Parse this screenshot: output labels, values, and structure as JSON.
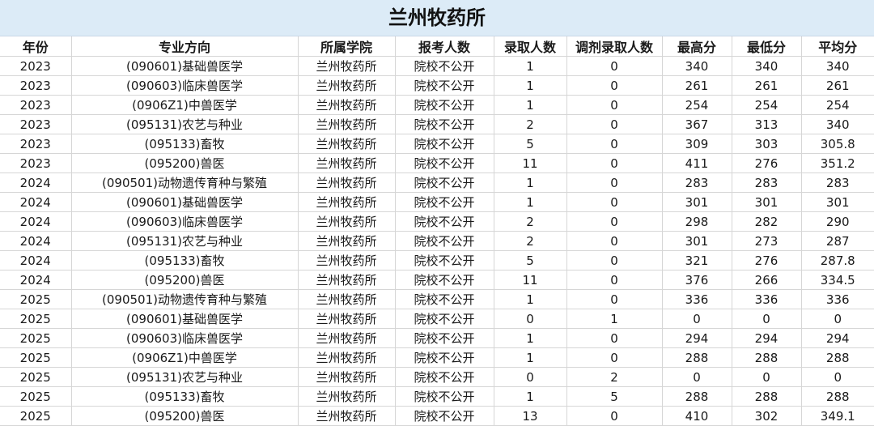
{
  "title": "兰州牧药所",
  "headers": [
    "年份",
    "专业方向",
    "所属学院",
    "报考人数",
    "录取人数",
    "调剂录取人数",
    "最高分",
    "最低分",
    "平均分"
  ],
  "rows": [
    [
      "2023",
      "(090601)基础兽医学",
      "兰州牧药所",
      "院校不公开",
      "1",
      "0",
      "340",
      "340",
      "340"
    ],
    [
      "2023",
      "(090603)临床兽医学",
      "兰州牧药所",
      "院校不公开",
      "1",
      "0",
      "261",
      "261",
      "261"
    ],
    [
      "2023",
      "(0906Z1)中兽医学",
      "兰州牧药所",
      "院校不公开",
      "1",
      "0",
      "254",
      "254",
      "254"
    ],
    [
      "2023",
      "(095131)农艺与种业",
      "兰州牧药所",
      "院校不公开",
      "2",
      "0",
      "367",
      "313",
      "340"
    ],
    [
      "2023",
      "(095133)畜牧",
      "兰州牧药所",
      "院校不公开",
      "5",
      "0",
      "309",
      "303",
      "305.8"
    ],
    [
      "2023",
      "(095200)兽医",
      "兰州牧药所",
      "院校不公开",
      "11",
      "0",
      "411",
      "276",
      "351.2"
    ],
    [
      "2024",
      "(090501)动物遗传育种与繁殖",
      "兰州牧药所",
      "院校不公开",
      "1",
      "0",
      "283",
      "283",
      "283"
    ],
    [
      "2024",
      "(090601)基础兽医学",
      "兰州牧药所",
      "院校不公开",
      "1",
      "0",
      "301",
      "301",
      "301"
    ],
    [
      "2024",
      "(090603)临床兽医学",
      "兰州牧药所",
      "院校不公开",
      "2",
      "0",
      "298",
      "282",
      "290"
    ],
    [
      "2024",
      "(095131)农艺与种业",
      "兰州牧药所",
      "院校不公开",
      "2",
      "0",
      "301",
      "273",
      "287"
    ],
    [
      "2024",
      "(095133)畜牧",
      "兰州牧药所",
      "院校不公开",
      "5",
      "0",
      "321",
      "276",
      "287.8"
    ],
    [
      "2024",
      "(095200)兽医",
      "兰州牧药所",
      "院校不公开",
      "11",
      "0",
      "376",
      "266",
      "334.5"
    ],
    [
      "2025",
      "(090501)动物遗传育种与繁殖",
      "兰州牧药所",
      "院校不公开",
      "1",
      "0",
      "336",
      "336",
      "336"
    ],
    [
      "2025",
      "(090601)基础兽医学",
      "兰州牧药所",
      "院校不公开",
      "0",
      "1",
      "0",
      "0",
      "0"
    ],
    [
      "2025",
      "(090603)临床兽医学",
      "兰州牧药所",
      "院校不公开",
      "1",
      "0",
      "294",
      "294",
      "294"
    ],
    [
      "2025",
      "(0906Z1)中兽医学",
      "兰州牧药所",
      "院校不公开",
      "1",
      "0",
      "288",
      "288",
      "288"
    ],
    [
      "2025",
      "(095131)农艺与种业",
      "兰州牧药所",
      "院校不公开",
      "0",
      "2",
      "0",
      "0",
      "0"
    ],
    [
      "2025",
      "(095133)畜牧",
      "兰州牧药所",
      "院校不公开",
      "1",
      "5",
      "288",
      "288",
      "288"
    ],
    [
      "2025",
      "(095200)兽医",
      "兰州牧药所",
      "院校不公开",
      "13",
      "0",
      "410",
      "302",
      "349.1"
    ]
  ]
}
